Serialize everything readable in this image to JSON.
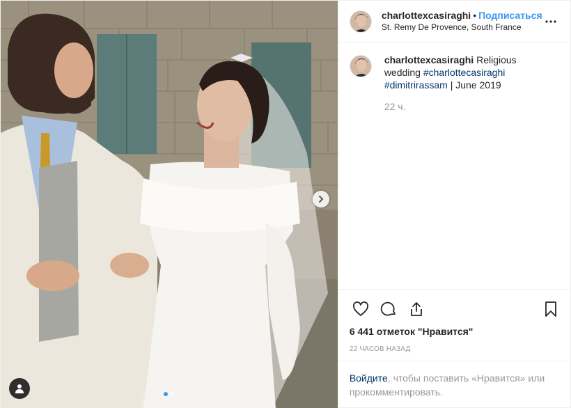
{
  "post": {
    "username": "charlottexcasiraghi",
    "separator": "•",
    "follow_label": "Подписаться",
    "location": "St. Remy De Provence, South France"
  },
  "caption": {
    "username": "charlottexcasiraghi",
    "text": "Religious wedding",
    "hashtag_1": "#charlottecasiraghi",
    "hashtag_2": "#dimitrirassam",
    "suffix": "| June 2019",
    "time": "22 ч."
  },
  "actions": {
    "icons": [
      "heart-icon",
      "comment-icon",
      "share-icon",
      "bookmark-icon"
    ]
  },
  "likes_text": "6 441 отметок \"Нравится\"",
  "posted_ago": "22 ЧАСОВ НАЗАД",
  "login_prompt": {
    "link": "Войдите",
    "text": ", чтобы поставить «Нравится» или прокомментировать."
  },
  "carousel": {
    "slide_count": 2,
    "active_index": 0
  },
  "colors": {
    "link_blue": "#3897f0",
    "hashtag": "#003569",
    "muted": "#999999"
  }
}
